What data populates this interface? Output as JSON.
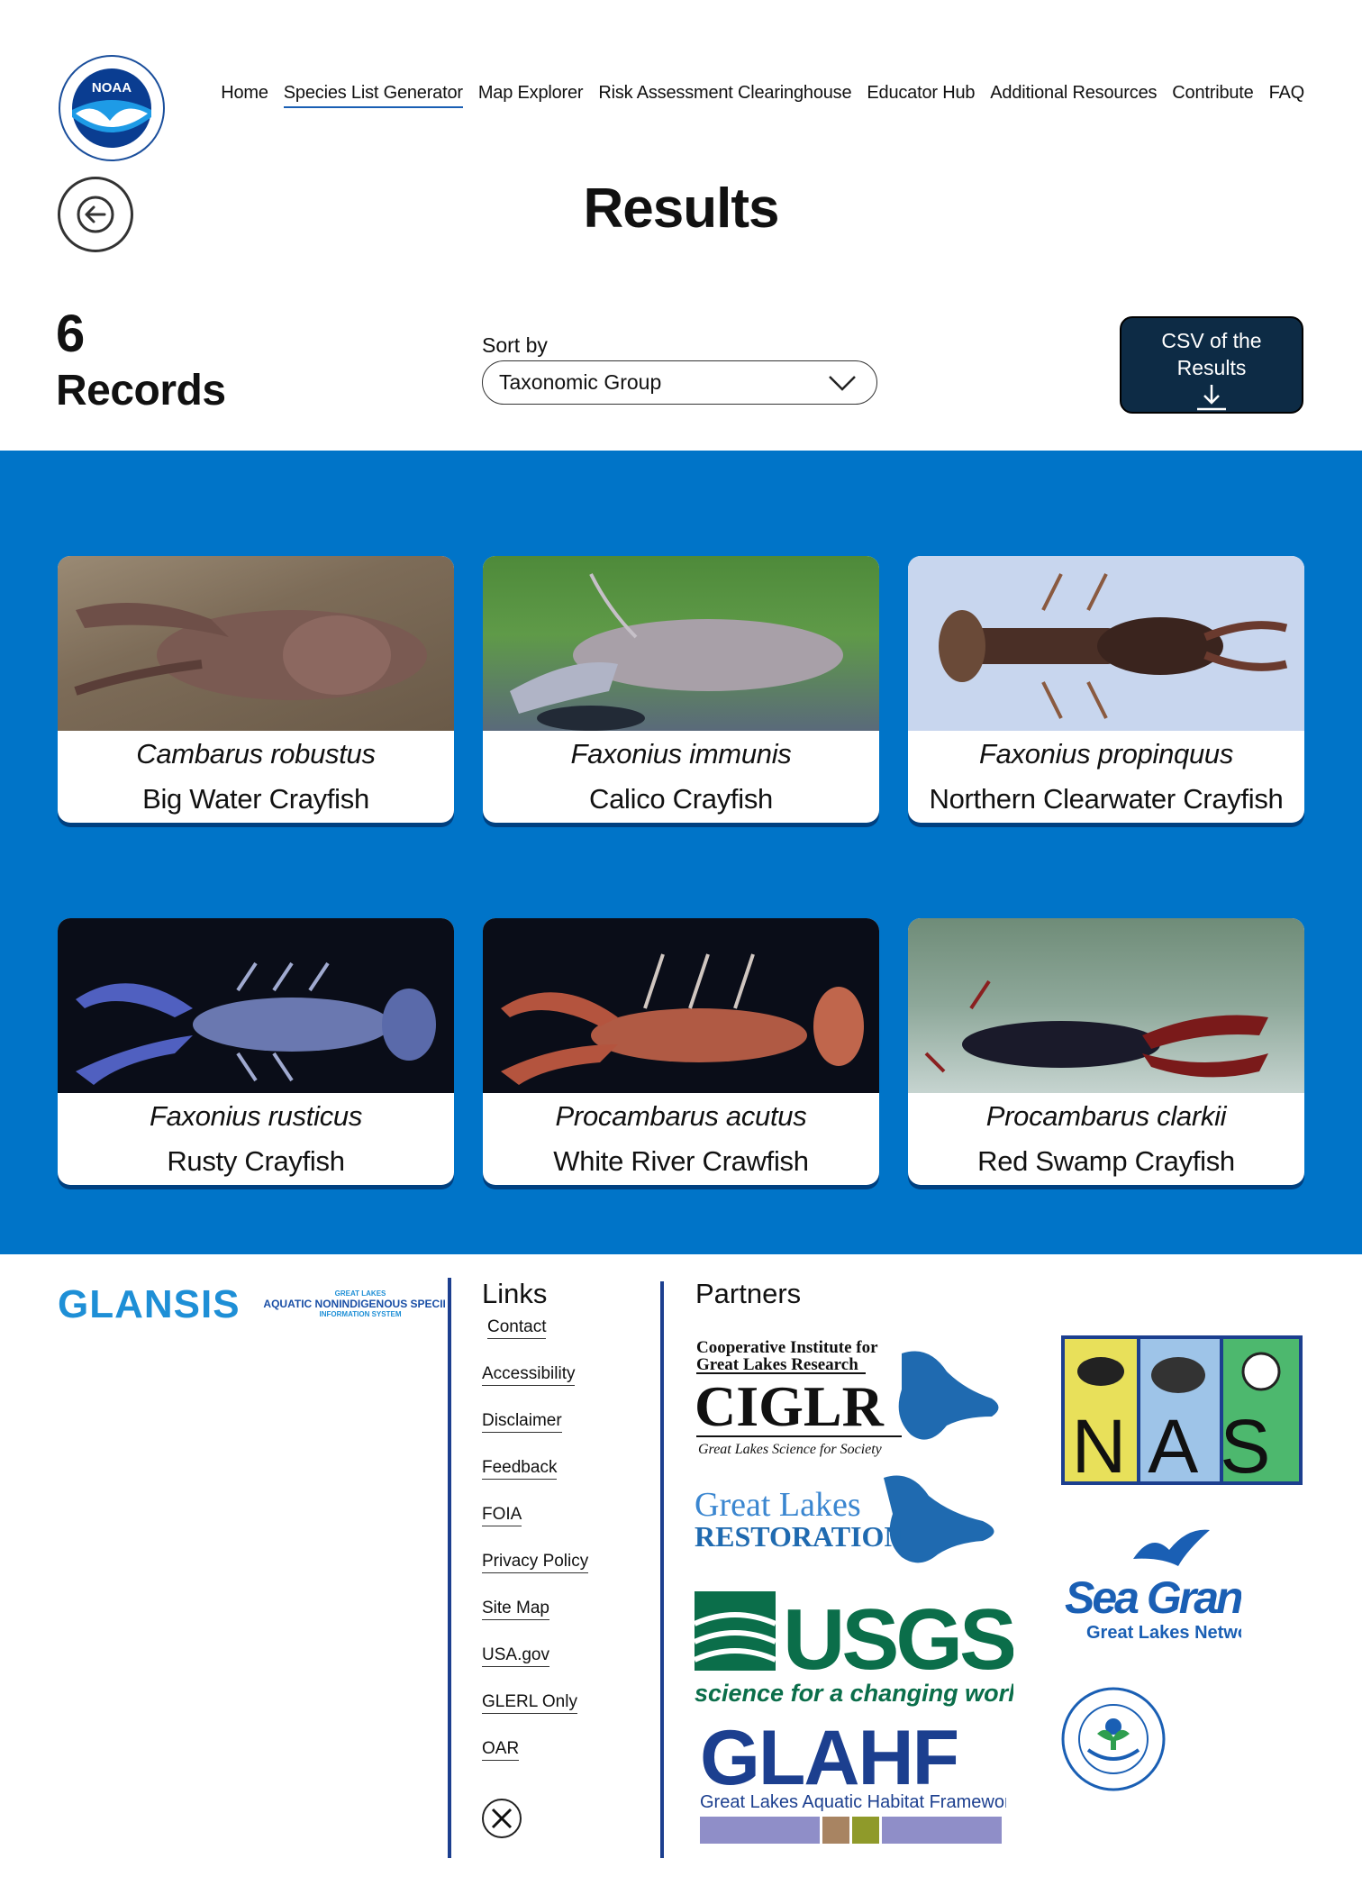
{
  "header": {
    "nav": [
      {
        "label": "Home",
        "active": false
      },
      {
        "label": "Species List Generator",
        "active": true
      },
      {
        "label": "Map Explorer",
        "active": false
      },
      {
        "label": "Risk Assessment Clearinghouse",
        "active": false
      },
      {
        "label": "Educator Hub",
        "active": false
      },
      {
        "label": "Additional Resources",
        "active": false
      },
      {
        "label": "Contribute",
        "active": false
      },
      {
        "label": "FAQ",
        "active": false
      }
    ],
    "logo_text": "NOAA"
  },
  "page": {
    "title": "Results",
    "record_count": "6",
    "record_label": "Records",
    "sort_label": "Sort by",
    "sort_value": "Taxonomic Group",
    "csv_line1": "CSV of the",
    "csv_line2": "Results"
  },
  "species": [
    {
      "scientific": "Cambarus robustus",
      "common": "Big Water Crayfish"
    },
    {
      "scientific": "Faxonius immunis",
      "common": "Calico Crayfish"
    },
    {
      "scientific": "Faxonius propinquus",
      "common": "Northern Clearwater Crayfish"
    },
    {
      "scientific": "Faxonius rusticus",
      "common": "Rusty Crayfish"
    },
    {
      "scientific": "Procambarus acutus",
      "common": "White River Crawfish"
    },
    {
      "scientific": "Procambarus clarkii",
      "common": "Red Swamp Crayfish"
    }
  ],
  "footer": {
    "brand": "GLANSIS",
    "brand_sub1": "GREAT LAKES",
    "brand_sub2": "AQUATIC NONINDIGENOUS SPECIES",
    "brand_sub3": "INFORMATION SYSTEM",
    "links_title": "Links",
    "links": [
      "Contact",
      "Accessibility",
      "Disclaimer",
      "Feedback",
      "FOIA",
      "Privacy Policy",
      "Site Map",
      "USA.gov",
      "GLERL Only",
      "OAR"
    ],
    "partners_title": "Partners",
    "ciglr_l1": "Cooperative Institute for",
    "ciglr_l2": "Great Lakes Research",
    "ciglr_main": "CIGLR",
    "ciglr_tag": "Great Lakes Science for Society",
    "glri_l1": "Great Lakes",
    "glri_l2": "RESTORATION",
    "usgs_main": "USGS",
    "usgs_tag": "science for a changing world",
    "glahf_main": "GLAHF",
    "glahf_tag": "Great Lakes Aquatic Habitat Framework",
    "nas_main": "NAS",
    "seagrant_main": "Sea Grant",
    "seagrant_tag": "Great Lakes Network"
  },
  "colors": {
    "band": "#0074c8",
    "csv_button": "#0d2b45",
    "divider": "#1c3f8f"
  }
}
